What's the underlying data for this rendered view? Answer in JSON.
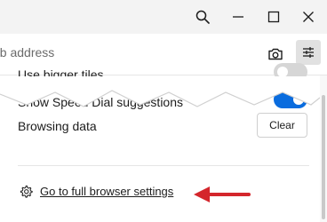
{
  "titlebar": {
    "icons": [
      "search-icon",
      "minimize-icon",
      "maximize-icon",
      "close-icon"
    ]
  },
  "address_bar": {
    "placeholder": "eb address",
    "camera_icon": "camera-icon",
    "settings_icon": "sliders-icon"
  },
  "settings": {
    "bigger_tiles_label": "Use bigger tiles",
    "bigger_tiles_enabled": false,
    "suggestions_label": "Show Speed Dial suggestions",
    "suggestions_enabled": true,
    "browsing_data_label": "Browsing data",
    "clear_label": "Clear",
    "full_settings_label": "Go to full browser settings"
  },
  "colors": {
    "accent": "#0a6cde",
    "toggle_off": "#d6d6d6",
    "arrow": "#d4262c",
    "titlebar_bg": "#f3f3f3"
  }
}
